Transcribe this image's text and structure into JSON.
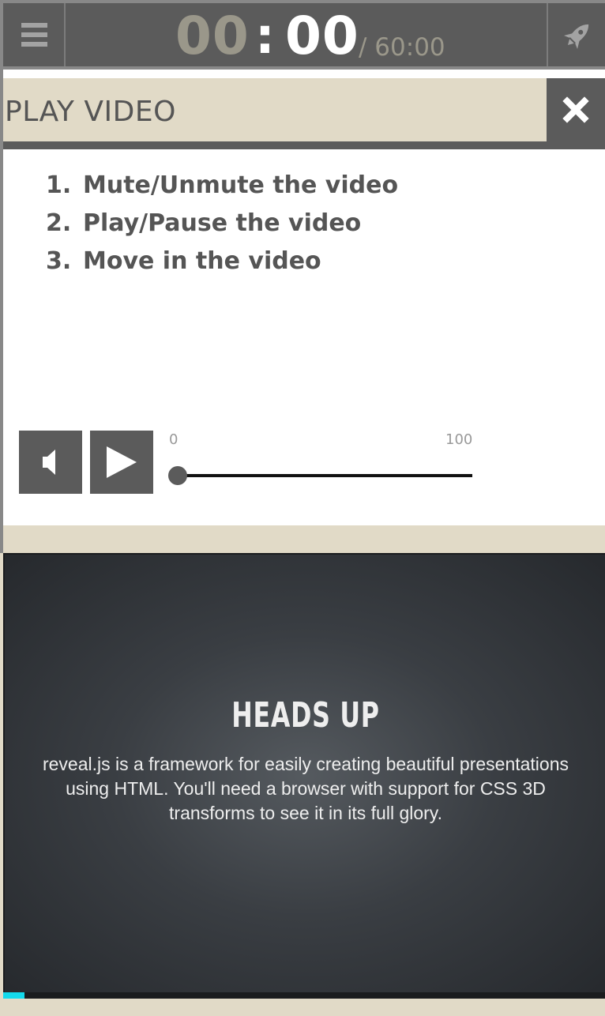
{
  "timer": {
    "minutes": "00",
    "separator": ":",
    "seconds": "00",
    "total": "/ 60:00"
  },
  "toolbar": {
    "menu_icon": "hamburger-icon",
    "rocket_icon": "rocket-icon"
  },
  "panel": {
    "title": "PLAY VIDEO",
    "close_icon": "close-icon",
    "steps": [
      {
        "num": "1.",
        "text": "Mute/Unmute the video"
      },
      {
        "num": "2.",
        "text": "Play/Pause the video"
      },
      {
        "num": "3.",
        "text": "Move in the video"
      }
    ],
    "controls": {
      "mute_icon": "speaker-icon",
      "play_icon": "play-icon",
      "slider_min": "0",
      "slider_max": "100",
      "slider_value": 0
    }
  },
  "slide": {
    "title": "HEADS UP",
    "text": "reveal.js is a framework for easily creating beautiful presentations using HTML. You'll need a browser with support for CSS 3D transforms to see it in its full glory.",
    "progress": 0.035
  },
  "colors": {
    "accent": "#13daec",
    "dark": "#5b5b5b",
    "beige": "#e1dac7"
  }
}
